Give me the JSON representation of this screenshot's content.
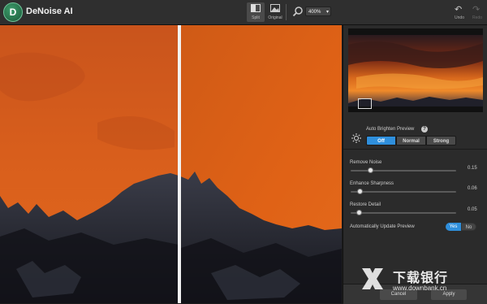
{
  "app": {
    "logo_letter": "D",
    "title": "DeNoise AI"
  },
  "toolbar": {
    "split_label": "Split",
    "original_label": "Original",
    "zoom_value": "400%",
    "undo_label": "Undo",
    "redo_label": "Redo"
  },
  "preview": {
    "auto_brighten_label": "Auto Brighten Preview",
    "help_glyph": "?",
    "modes": [
      "Off",
      "Normal",
      "Strong"
    ],
    "selected_mode": "Off"
  },
  "sliders": [
    {
      "label": "Remove Noise",
      "value": "0.15",
      "fraction": 0.15
    },
    {
      "label": "Enhance Sharpness",
      "value": "0.06",
      "fraction": 0.06
    },
    {
      "label": "Restore Detail",
      "value": "0.05",
      "fraction": 0.05
    }
  ],
  "auto_update": {
    "label": "Automatically Update Preview",
    "yes": "Yes",
    "no": "No",
    "selected": "Yes"
  },
  "actions": {
    "cancel": "Cancel",
    "apply": "Apply"
  },
  "watermark": {
    "title": "下载银行",
    "url": "www.downbank.cn"
  },
  "colors": {
    "accent": "#2f8fdc",
    "sky_orange": "#e0621a",
    "panel": "#2b2b2b"
  }
}
